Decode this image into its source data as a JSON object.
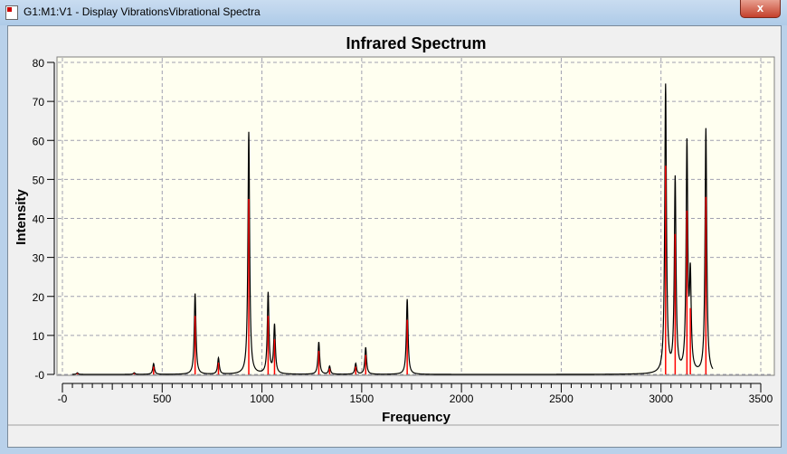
{
  "window": {
    "title": "G1:M1:V1 - Display VibrationsVibrational Spectra",
    "close_label": "x"
  },
  "colors": {
    "plot_bg": "#fffff0",
    "curve": "#000000",
    "sticks": "#ff0000",
    "grid": "#a0a0b0"
  },
  "chart_data": {
    "type": "line",
    "title": "Infrared Spectrum",
    "xlabel": "Frequency",
    "ylabel": "Intensity",
    "xlim": [
      0,
      3500
    ],
    "ylim": [
      0,
      80
    ],
    "grid": true,
    "xticks": [
      "-0",
      "500",
      "1000",
      "1500",
      "2000",
      "2500",
      "3000",
      "3500"
    ],
    "yticks": [
      "-0",
      "10",
      "20",
      "30",
      "40",
      "50",
      "60",
      "70",
      "80"
    ],
    "curve_range": [
      50,
      3260
    ],
    "sticks": [
      {
        "freq": 75,
        "intensity": 0.3
      },
      {
        "freq": 360,
        "intensity": 0.3
      },
      {
        "freq": 457,
        "intensity": 2.0
      },
      {
        "freq": 665,
        "intensity": 15.0
      },
      {
        "freq": 782,
        "intensity": 3.0
      },
      {
        "freq": 934,
        "intensity": 45.0
      },
      {
        "freq": 1031,
        "intensity": 15.0
      },
      {
        "freq": 1063,
        "intensity": 9.0
      },
      {
        "freq": 1285,
        "intensity": 6.0
      },
      {
        "freq": 1339,
        "intensity": 1.5
      },
      {
        "freq": 1470,
        "intensity": 2.0
      },
      {
        "freq": 1520,
        "intensity": 5.0
      },
      {
        "freq": 1728,
        "intensity": 14.0
      },
      {
        "freq": 3023,
        "intensity": 53.5
      },
      {
        "freq": 3071,
        "intensity": 36.0
      },
      {
        "freq": 3130,
        "intensity": 42.0
      },
      {
        "freq": 3147,
        "intensity": 17.0
      },
      {
        "freq": 3225,
        "intensity": 45.5
      }
    ]
  }
}
